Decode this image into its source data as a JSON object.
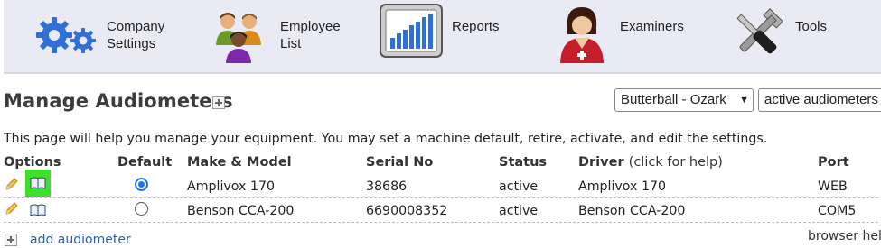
{
  "nav": {
    "items": [
      {
        "line1": "Company",
        "line2": "Settings",
        "icon": "gears-icon"
      },
      {
        "line1": "Employee",
        "line2": "List",
        "icon": "people-icon"
      },
      {
        "line1": "Reports",
        "line2": "",
        "icon": "bar-chart-icon"
      },
      {
        "line1": "Examiners",
        "line2": "",
        "icon": "examiner-icon"
      },
      {
        "line1": "Tools",
        "line2": "",
        "icon": "tools-icon"
      }
    ]
  },
  "page": {
    "title": "Manage Audiometers",
    "intro": "This page will help you manage your equipment. You may set a machine default, retire, activate, and edit the settings."
  },
  "filters": {
    "location": "Butterball - Ozark",
    "status_filter": "active audiometers"
  },
  "table": {
    "headers": {
      "options": "Options",
      "default": "Default",
      "make_model": "Make & Model",
      "serial": "Serial No",
      "status": "Status",
      "driver": "Driver",
      "driver_note": "(click for help)",
      "port": "Port"
    },
    "rows": [
      {
        "default": true,
        "make_model": "Amplivox 170",
        "serial": "38686",
        "status": "active",
        "driver": "Amplivox 170",
        "port": "WEB",
        "highlighted": true
      },
      {
        "default": false,
        "make_model": "Benson CCA-200",
        "serial": "6690008352",
        "status": "active",
        "driver": "Benson CCA-200",
        "port": "COM5",
        "highlighted": false
      }
    ]
  },
  "footer": {
    "add_label": "add audiometer",
    "browser_help": "browser help"
  },
  "colors": {
    "nav_bg": "#eaeaf4",
    "link": "#2a5db0",
    "radio_selected": "#1a73e8",
    "highlight": "#3de02a"
  }
}
